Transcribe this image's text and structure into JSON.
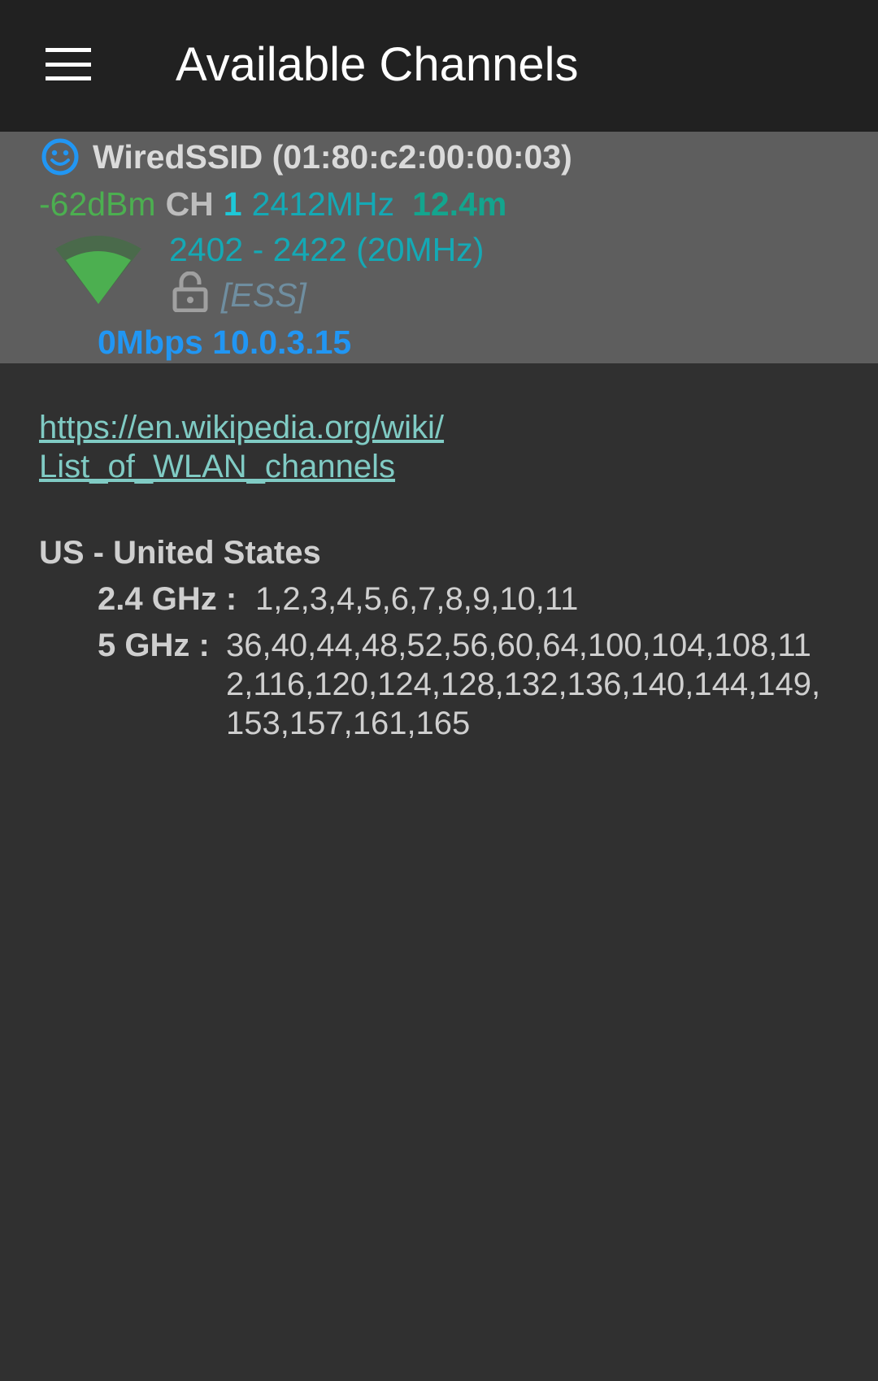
{
  "app_bar": {
    "menu_icon": "menu-icon",
    "title": "Available Channels"
  },
  "access_point": {
    "status_icon": "smiley-icon",
    "ssid": "WiredSSID (01:80:c2:00:00:03)",
    "signal": "-62dBm",
    "channel_label": "CH",
    "channel": "1",
    "frequency": "2412MHz",
    "distance": "12.4m",
    "wifi_icon": "wifi-signal-icon",
    "range": "2402 - 2422 (20MHz)",
    "security_icon": "unlocked-icon",
    "capabilities": "[ESS]",
    "speed_ip": "0Mbps 10.0.3.15",
    "colors": {
      "signal": "#4caf50",
      "channel": "#1ec8d8",
      "frequency": "#14a9b5",
      "distance": "#13a58e",
      "speed": "#2196f3"
    }
  },
  "reference": {
    "link_line1": "https://en.wikipedia.org/wiki/",
    "link_line2": "List_of_WLAN_channels"
  },
  "country": {
    "name": "US - United States",
    "bands": [
      {
        "label": "2.4 GHz :",
        "values": "1,2,3,4,5,6,7,8,9,10,11"
      },
      {
        "label": "5 GHz :",
        "values_line1": "36,40,44,48,52,56,60,64,100,104,108,11",
        "values_line2": "2,116,120,124,128,132,136,140,144,149,",
        "values_line3": "153,157,161,165"
      }
    ]
  }
}
